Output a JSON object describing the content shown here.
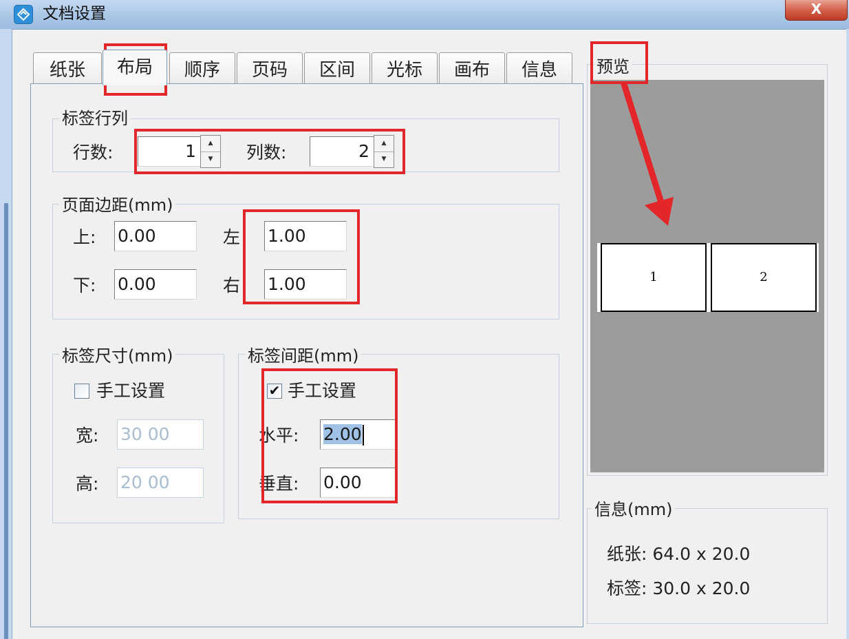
{
  "window": {
    "title": "文档设置",
    "close_glyph": "X"
  },
  "tabs": [
    {
      "label": "纸张"
    },
    {
      "label": "布局"
    },
    {
      "label": "顺序"
    },
    {
      "label": "页码"
    },
    {
      "label": "区间"
    },
    {
      "label": "光标"
    },
    {
      "label": "画布"
    },
    {
      "label": "信息"
    }
  ],
  "active_tab": "布局",
  "rows_cols": {
    "title": "标签行列",
    "rows_label": "行数:",
    "rows_value": "1",
    "cols_label": "列数:",
    "cols_value": "2",
    "spin_up": "▲",
    "spin_down": "▼"
  },
  "margins": {
    "title": "页面边距(mm)",
    "top_label": "上:",
    "top_value": "0.00",
    "bottom_label": "下:",
    "bottom_value": "0.00",
    "left_label": "左",
    "left_value": "1.00",
    "right_label": "右",
    "right_value": "1.00"
  },
  "label_size": {
    "title": "标签尺寸(mm)",
    "manual_label": "手工设置",
    "manual_checked": false,
    "width_label": "宽:",
    "width_value": "30 00",
    "height_label": "高:",
    "height_value": "20 00"
  },
  "label_spacing": {
    "title": "标签间距(mm)",
    "manual_label": "手工设置",
    "manual_checked": true,
    "check_glyph": "✔",
    "horizontal_label": "水平:",
    "horizontal_value": "2.00",
    "vertical_label": "垂直:",
    "vertical_value": "0.00"
  },
  "preview": {
    "title": "预览",
    "labels": [
      "1",
      "2"
    ],
    "background_color": "#9c9c9c"
  },
  "info": {
    "title": "信息(mm)",
    "paper_line": "纸张: 64.0 x 20.0",
    "label_line": "标签: 30.0 x 20.0"
  },
  "colors": {
    "annotation_red": "#e3262a",
    "selection_blue": "#9fc2e6",
    "titlebar_blue": "#a9c6e6"
  }
}
